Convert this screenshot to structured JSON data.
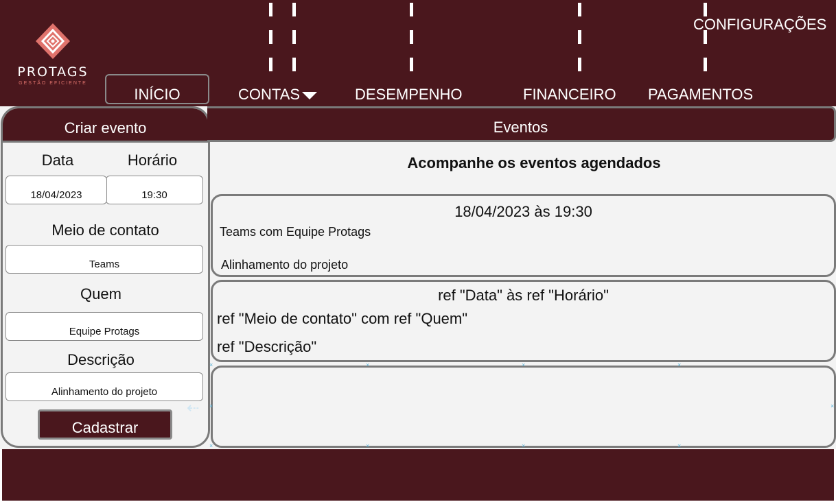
{
  "brand": {
    "name": "PROTAGS",
    "tagline": "GESTÃO EFICIENTE"
  },
  "nav": {
    "inicio": "INÍCIO",
    "contas": "CONTAS",
    "desempenho": "DESEMPENHO",
    "financeiro": "FINANCEIRO",
    "pagamentos": "PAGAMENTOS",
    "configuracoes": "CONFIGURAÇÕES"
  },
  "create_event": {
    "title": "Criar evento",
    "date_label": "Data",
    "time_label": "Horário",
    "date_value": "18/04/2023",
    "time_value": "19:30",
    "contact_label": "Meio de contato",
    "contact_value": "Teams",
    "who_label": "Quem",
    "who_value": "Equipe Protags",
    "description_label": "Descrição",
    "description_value": "Alinhamento do projeto",
    "submit_label": "Cadastrar"
  },
  "events": {
    "title": "Eventos",
    "subtitle": "Acompanhe os eventos agendados",
    "cards": [
      {
        "datetime": "18/04/2023 às 19:30",
        "contact": "Teams com Equipe Protags",
        "description": "Alinhamento do projeto"
      },
      {
        "datetime": "ref \"Data\" às ref \"Horário\"",
        "contact": "ref \"Meio de contato\" com ref \"Quem\"",
        "description": "ref \"Descrição\""
      }
    ]
  },
  "colors": {
    "brand_dark": "#4a171d",
    "accent": "#e0736c",
    "border": "#7a7a7a",
    "panel_bg": "#f3f3f3"
  }
}
